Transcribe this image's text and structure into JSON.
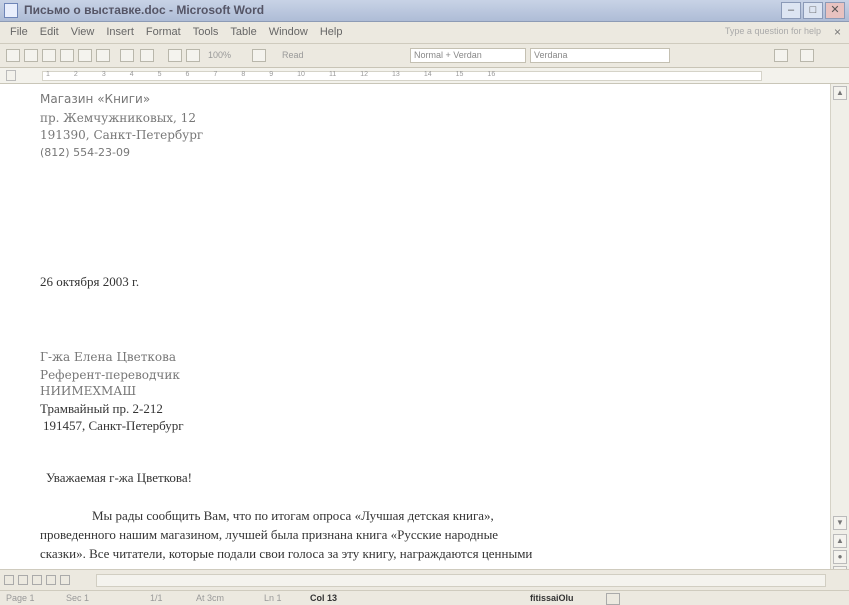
{
  "window": {
    "title": "Письмо о выставке.doc - Microsoft Word"
  },
  "menu": {
    "items": [
      "File",
      "Edit",
      "View",
      "Insert",
      "Format",
      "Tools",
      "Table",
      "Window",
      "Help"
    ],
    "help_placeholder": "Type a question for help",
    "close_doc": "×"
  },
  "toolbar": {
    "zoom": "100%",
    "read": "Read",
    "style": "Normal + Verdan",
    "font": "Verdana"
  },
  "ruler": {
    "numbers": [
      "1",
      "2",
      "3",
      "4",
      "5",
      "6",
      "7",
      "8",
      "9",
      "10",
      "11",
      "12",
      "13",
      "14",
      "15",
      "16"
    ]
  },
  "document": {
    "sender": {
      "name": "Магазин «Книги»",
      "street": "пр. Жемчужниковых, 12",
      "city": "191390, Санкт-Петербург",
      "phone": "(812) 554-23-09"
    },
    "date": "26 октября 2003 г.",
    "recipient": {
      "name": "Г-жа Елена Цветкова",
      "title": "Референт-переводчик",
      "org": "НИИМЕХМАШ",
      "street": "Трамвайный пр. 2-212",
      "city": "191457, Санкт-Петербург"
    },
    "salutation": "Уважаемая г-жа Цветкова!",
    "body_lines": [
      "Мы рады сообщить Вам, что по итогам опроса «Лучшая детская книга»,",
      "проведенного нашим магазином, лучшей была признана книга «Русские народные",
      "сказки». Все читатели, которые подали свои голоса за эту книгу, награждаются ценными"
    ]
  },
  "status": {
    "page": "Page 1",
    "sec": "Sec 1",
    "pages": "1/1",
    "at": "At 3cm",
    "ln": "Ln 1",
    "col": "Col 13",
    "lang": "fitissaiOlu"
  }
}
